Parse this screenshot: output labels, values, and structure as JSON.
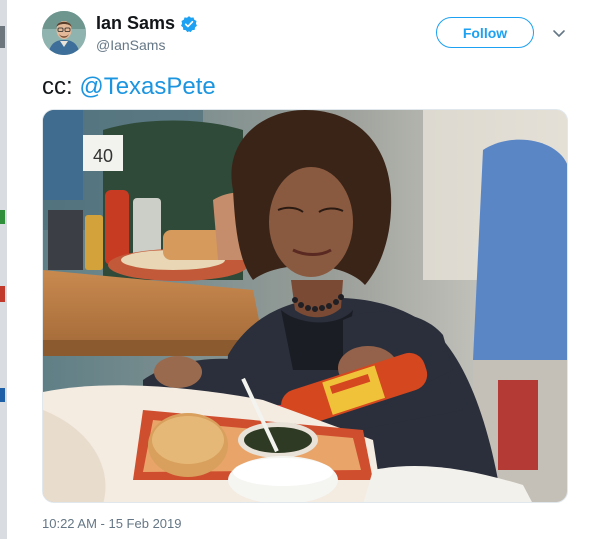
{
  "tweet": {
    "author": {
      "name": "Ian Sams",
      "handle": "@IanSams",
      "avatar_icon": "profile-photo-avatar",
      "verified_icon": "verified-badge-icon",
      "verified_color": "#1da1f2"
    },
    "follow_label": "Follow",
    "menu_icon": "chevron-down-icon",
    "text_prefix": "cc: ",
    "mention": "@TexasPete",
    "timestamp": "10:22 AM - 15 Feb 2019"
  },
  "photo": {
    "sign_number": "40"
  },
  "colors": {
    "accent": "#1da1f2",
    "mention": "#1b95e0",
    "secondary_text": "#657786"
  }
}
